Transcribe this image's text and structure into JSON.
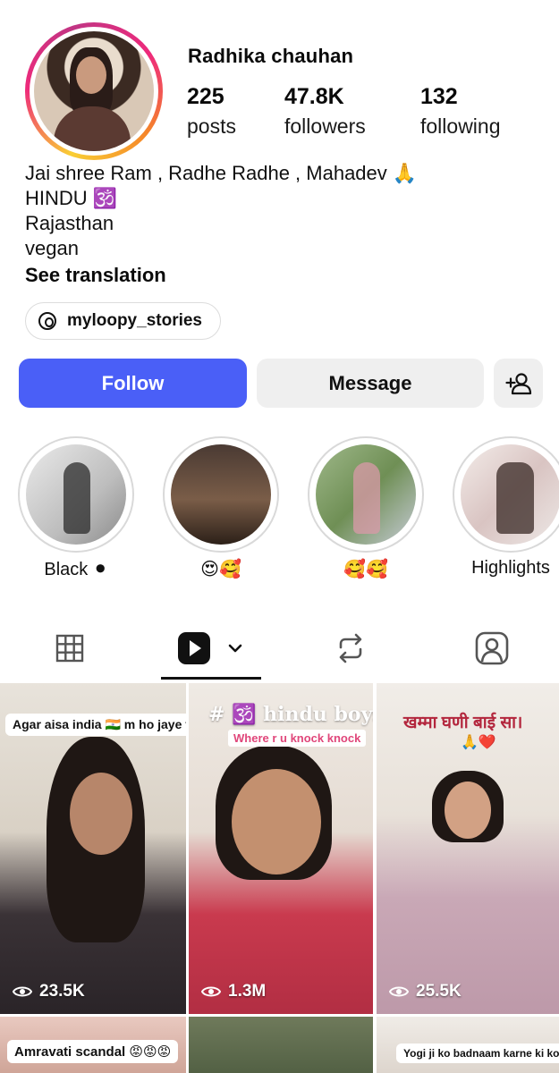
{
  "profile": {
    "username": "Radhika chauhan",
    "stats": {
      "posts": {
        "value": "225",
        "label": "posts"
      },
      "followers": {
        "value": "47.8K",
        "label": "followers"
      },
      "following": {
        "value": "132",
        "label": "following"
      }
    },
    "bio": [
      "Jai shree Ram , Radhe Radhe , Mahadev 🙏",
      "HINDU 🕉️",
      "Rajasthan",
      "vegan"
    ],
    "see_translation": "See translation",
    "threads_handle": "myloopy_stories"
  },
  "actions": {
    "follow": "Follow",
    "message": "Message",
    "add_friend_icon": "add-person-icon"
  },
  "highlights": [
    {
      "label": "Black ⚫"
    },
    {
      "label": "😍🥰"
    },
    {
      "label": "🥰🥰"
    },
    {
      "label": "Highlights"
    }
  ],
  "tabs": {
    "grid_icon": "grid-icon",
    "reels_icon": "reels-icon",
    "reposts_icon": "repost-icon",
    "tagged_icon": "tagged-icon",
    "active": "reels"
  },
  "reels": [
    {
      "caption": "Agar aisa india 🇮🇳 m ho jaye toh ?",
      "views": "23.5K"
    },
    {
      "caption": "# 🕉️ hindu boys",
      "subcaption": "Where r u knock knock",
      "views": "1.3M"
    },
    {
      "caption": "खम्मा घणी बाई सा।",
      "emoji": "🙏❤️",
      "views": "25.5K"
    },
    {
      "caption": "Amravati scandal 😡😡😡"
    },
    {
      "caption": ""
    },
    {
      "caption": "Yogi ji ko badnaam karne ki koshish"
    }
  ],
  "colors": {
    "follow_button": "#4a5ff7",
    "secondary_button": "#efefef",
    "text": "#0a0a0a"
  }
}
